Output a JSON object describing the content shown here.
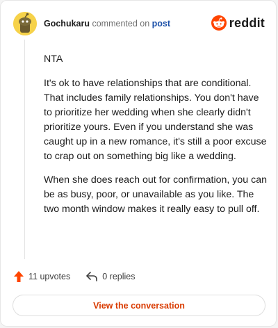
{
  "comment": {
    "username": "Gochukaru",
    "action_text": "commented on",
    "post_link": "post",
    "paragraphs": [
      "NTA",
      "It's ok to have relationships that are conditional. That includes family relationships. You don't have to prioritize her wedding when she clearly didn't prioritize yours. Even if you understand she was caught up in a new romance, it's still a poor excuse to crap out on something big like a wedding.",
      "When she does reach out for confirmation, you can be as busy, poor, or unavailable as you like. The two month window makes it really easy to pull off."
    ]
  },
  "brand": {
    "name": "reddit",
    "color": "#ff4500"
  },
  "footer": {
    "upvotes": "11 upvotes",
    "replies": "0 replies"
  },
  "cta": {
    "label": "View the conversation"
  },
  "icons": {
    "avatar": "snoo-avatar",
    "brand": "reddit-logo-icon",
    "upvote": "upvote-arrow-icon",
    "reply": "reply-arrow-icon"
  },
  "colors": {
    "accent": "#d93a00",
    "upvote": "#ff4500",
    "link": "#1a4fa8",
    "avatar_bg": "#f6d24a"
  }
}
